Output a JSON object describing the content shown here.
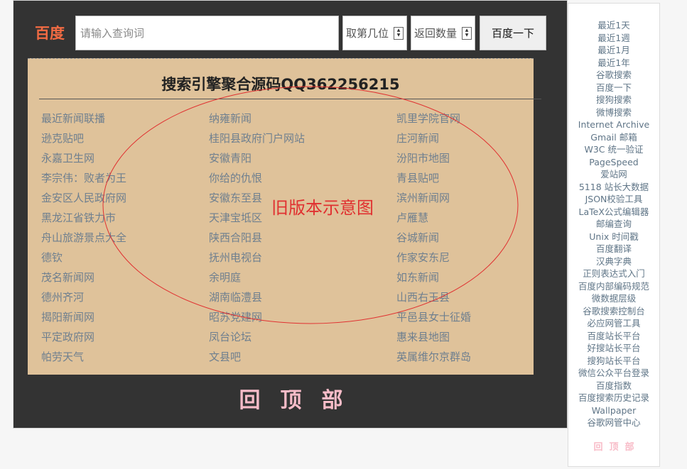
{
  "header": {
    "logo": "百度",
    "search_placeholder": "请输入查询词",
    "position_placeholder": "取第几位",
    "count_placeholder": "返回数量",
    "search_button": "百度一下"
  },
  "panel": {
    "title": "搜索引擎聚合源码QQ362256215",
    "annotation": "旧版本示意图",
    "col1": [
      "最近新闻联播",
      "逊克贴吧",
      "永嘉卫生网",
      "李宗伟：败者为王",
      "金安区人民政府网",
      "黑龙江省铁力市",
      "舟山旅游景点大全",
      "德钦",
      "茂名新闻网",
      "德州齐河",
      "揭阳新闻网",
      "平定政府网",
      "帕劳天气"
    ],
    "col2": [
      "纳雍新闻",
      "桂阳县政府门户网站",
      "安徽青阳",
      "你给的仇恨",
      "安徽东至县",
      "天津宝坻区",
      "陕西合阳县",
      "抚州电视台",
      "余明庭",
      "湖南临澧县",
      "昭苏党建网",
      "凤台论坛",
      "文县吧"
    ],
    "col3": [
      "凯里学院官网",
      "庄河新闻",
      "汾阳市地图",
      "青县贴吧",
      "滨州新闻网",
      "卢雁慧",
      "谷城新闻",
      "作家安东尼",
      "如东新闻",
      "山西右玉县",
      "平邑县女士征婚",
      "惠来县地图",
      "英属维尔京群岛"
    ]
  },
  "back_to_top": "回顶部",
  "sidebar": {
    "links": [
      "最近1天",
      "最近1週",
      "最近1月",
      "最近1年",
      "谷歌搜索",
      "百度一下",
      "搜狗搜索",
      "微博搜索",
      "Internet Archive",
      "Gmail 邮箱",
      "W3C 统一验证",
      "PageSpeed",
      "爱站网",
      "5118 站长大数据",
      "JSON校验工具",
      "LaTeX公式编辑器",
      "邮编查询",
      "Unix 时间戳",
      "百度翻译",
      "汉典字典",
      "正则表达式入门",
      "百度内部编码规范",
      "微数据层级",
      "谷歌搜索控制台",
      "必应网管工具",
      "百度站长平台",
      "好搜站长平台",
      "搜狗站长平台",
      "微信公众平台登录",
      "百度指数",
      "百度搜索历史记录",
      "Wallpaper",
      "谷歌网管中心"
    ],
    "back_to_top": "回顶部"
  },
  "colors": {
    "logo": "#f26b43",
    "panel_bg": "#dfc29a",
    "link": "#6e7f8f",
    "annotation": "#e03030",
    "back_to_top": "#f8bcc8"
  }
}
